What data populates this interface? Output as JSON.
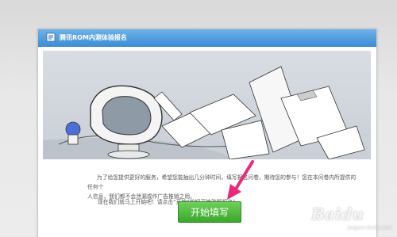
{
  "header": {
    "title": "腾讯ROM内测体验报名"
  },
  "intro": {
    "line1": "为了给您提供更好的服务，希望您能抽出几分钟时间，填写报名问卷，期待您的参与！您在本问卷内所提供的任何个",
    "line2": "人信息，我们都不会泄漏或作广告推销之用。",
    "start_hint": "现在我们就马上开始吧！请点击“开始”按钮开始答题报名！"
  },
  "start_button": {
    "label": "开始填写"
  },
  "watermark": {
    "text": "Baidu",
    "sub": "jingyan.baidu.com"
  },
  "colors": {
    "header_blue": "#3d8fd6",
    "button_green": "#3aa72a",
    "arrow_pink": "#e8297a"
  },
  "icons": {
    "header_icon": "document-icon",
    "arrow": "pointer-arrow-icon"
  }
}
